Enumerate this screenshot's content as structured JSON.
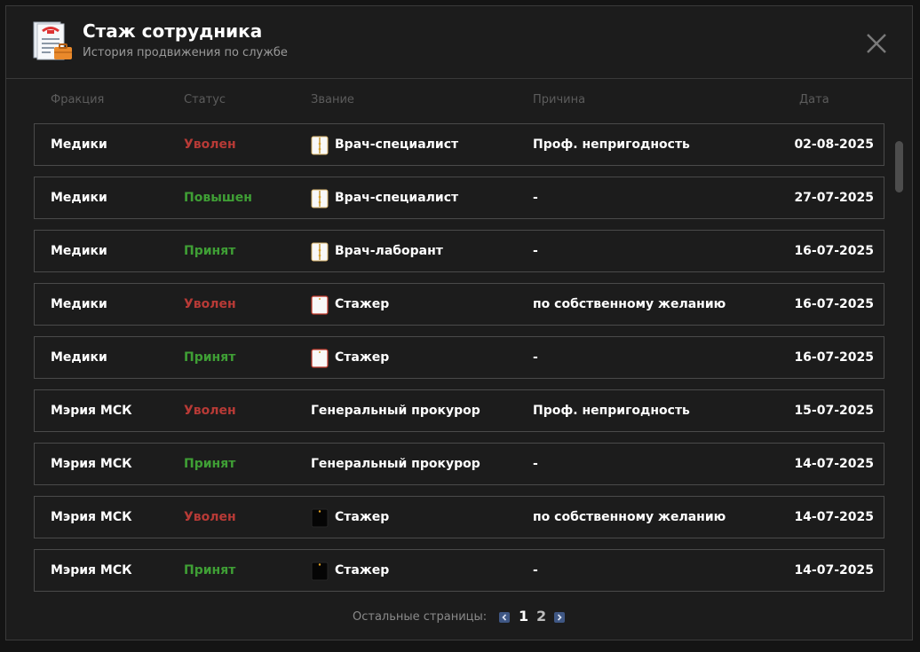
{
  "header": {
    "title": "Стаж сотрудника",
    "subtitle": "История продвижения по службе",
    "icon": "document-briefcase-icon",
    "close_icon": "close-icon"
  },
  "columns": [
    "Фракция",
    "Статус",
    "Звание",
    "Причина",
    "Дата"
  ],
  "rows": [
    {
      "faction": "Медики",
      "status": "Уволен",
      "status_type": "red",
      "rank": "Врач-специалист",
      "rank_icon": "medic-coat-icon",
      "reason": "Проф. непригодность",
      "date": "02-08-2025"
    },
    {
      "faction": "Медики",
      "status": "Повышен",
      "status_type": "green",
      "rank": "Врач-специалист",
      "rank_icon": "medic-coat-icon",
      "reason": "-",
      "date": "27-07-2025"
    },
    {
      "faction": "Медики",
      "status": "Принят",
      "status_type": "green",
      "rank": "Врач-лаборант",
      "rank_icon": "medic-coat-icon",
      "reason": "-",
      "date": "16-07-2025"
    },
    {
      "faction": "Медики",
      "status": "Уволен",
      "status_type": "red",
      "rank": "Стажер",
      "rank_icon": "intern-coat-icon",
      "reason": "по собственному желанию",
      "date": "16-07-2025"
    },
    {
      "faction": "Медики",
      "status": "Принят",
      "status_type": "green",
      "rank": "Стажер",
      "rank_icon": "intern-coat-icon",
      "reason": "-",
      "date": "16-07-2025"
    },
    {
      "faction": "Мэрия МСК",
      "status": "Уволен",
      "status_type": "red",
      "rank": "Генеральный прокурор",
      "rank_icon": "",
      "reason": "Проф. непригодность",
      "date": "15-07-2025"
    },
    {
      "faction": "Мэрия МСК",
      "status": "Принят",
      "status_type": "green",
      "rank": "Генеральный прокурор",
      "rank_icon": "",
      "reason": "-",
      "date": "14-07-2025"
    },
    {
      "faction": "Мэрия МСК",
      "status": "Уволен",
      "status_type": "red",
      "rank": "Стажер",
      "rank_icon": "black-uniform-icon",
      "reason": "по собственному желанию",
      "date": "14-07-2025"
    },
    {
      "faction": "Мэрия МСК",
      "status": "Принят",
      "status_type": "green",
      "rank": "Стажер",
      "rank_icon": "black-uniform-icon",
      "reason": "-",
      "date": "14-07-2025"
    }
  ],
  "pagination": {
    "label": "Остальные страницы:",
    "pages": [
      "1",
      "2"
    ],
    "current": "1"
  },
  "colors": {
    "status_red": "#b73a36",
    "status_green": "#3f9f35",
    "pager_arrow": "#3f5784"
  }
}
